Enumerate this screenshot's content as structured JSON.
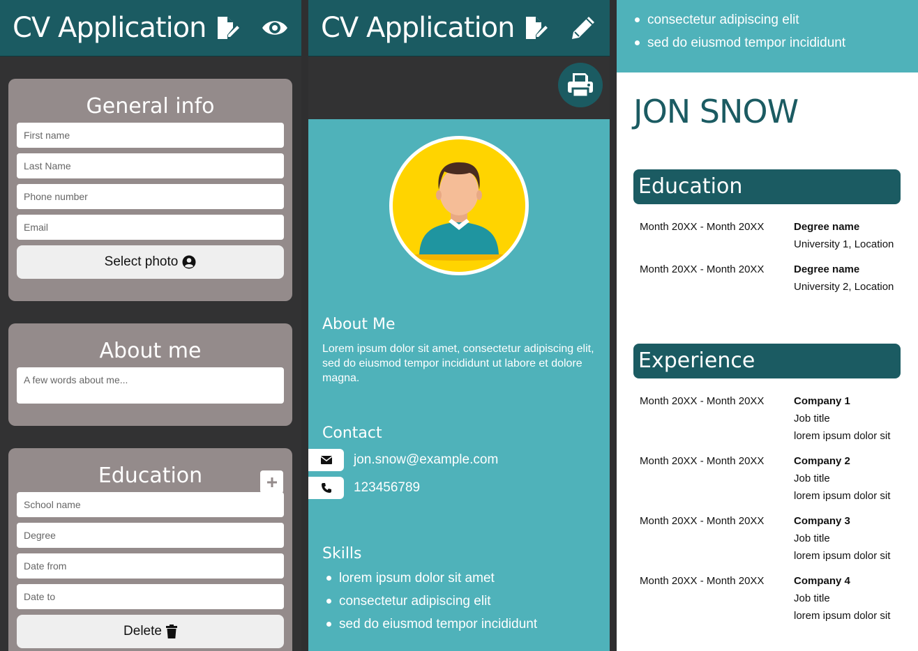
{
  "app": {
    "title": "CV Application"
  },
  "editor": {
    "general": {
      "title": "General info",
      "first_name_placeholder": "First name",
      "last_name_placeholder": "Last Name",
      "phone_placeholder": "Phone number",
      "email_placeholder": "Email",
      "select_photo_label": "Select photo"
    },
    "about": {
      "title": "About me",
      "placeholder": "A few words about me..."
    },
    "education": {
      "title": "Education",
      "school_placeholder": "School name",
      "degree_placeholder": "Degree",
      "date_from_placeholder": "Date from",
      "date_to_placeholder": "Date to",
      "delete_label": "Delete"
    }
  },
  "preview": {
    "about_title": "About Me",
    "about_text": "Lorem ipsum dolor sit amet, consectetur adipiscing elit, sed do eiusmod tempor incididunt ut labore et dolore magna.",
    "contact_title": "Contact",
    "email": "jon.snow@example.com",
    "phone": "123456789",
    "skills_title": "Skills",
    "skills": [
      "lorem ipsum dolor sit amet",
      "consectetur adipiscing elit",
      "sed do eiusmod tempor incididunt"
    ]
  },
  "resume": {
    "name": "JON SNOW",
    "top_skills": [
      "consectetur adipiscing elit",
      "sed do eiusmod tempor incididunt"
    ],
    "education_title": "Education",
    "education": [
      {
        "date": "Month 20XX - Month 20XX",
        "degree": "Degree name",
        "school": "University 1, Location"
      },
      {
        "date": "Month 20XX - Month 20XX",
        "degree": "Degree name",
        "school": "University 2, Location"
      }
    ],
    "experience_title": "Experience",
    "experience": [
      {
        "date": "Month 20XX - Month 20XX",
        "company": "Company 1",
        "job": "Job title",
        "desc": "lorem ipsum dolor sit"
      },
      {
        "date": "Month 20XX - Month 20XX",
        "company": "Company 2",
        "job": "Job title",
        "desc": "lorem ipsum dolor sit"
      },
      {
        "date": "Month 20XX - Month 20XX",
        "company": "Company 3",
        "job": "Job title",
        "desc": "lorem ipsum dolor sit"
      },
      {
        "date": "Month 20XX - Month 20XX",
        "company": "Company 4",
        "job": "Job title",
        "desc": "lorem ipsum dolor sit"
      }
    ]
  },
  "colors": {
    "header": "#1b5b62",
    "accent": "#4fb2ba",
    "card": "#948b8b",
    "background": "#323233"
  }
}
